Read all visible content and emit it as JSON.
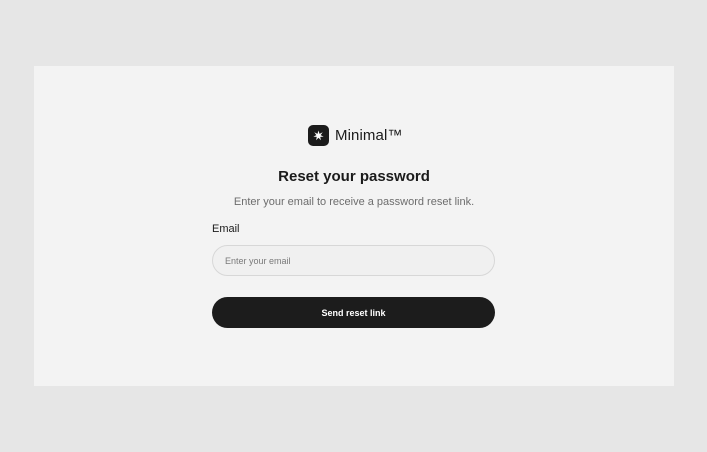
{
  "colors": {
    "page_background": "#e6e6e6",
    "card_background": "#f3f3f3",
    "accent": "#1c1c1c",
    "button_text": "#ffffff",
    "muted_text": "#6d6d6d"
  },
  "brand": {
    "icon": "sparkle-icon",
    "name": "Minimal™"
  },
  "form": {
    "title": "Reset your password",
    "subtitle": "Enter your email to receive a password reset link.",
    "email_label": "Email",
    "email_placeholder": "Enter your email",
    "email_value": "",
    "submit_label": "Send reset link"
  }
}
